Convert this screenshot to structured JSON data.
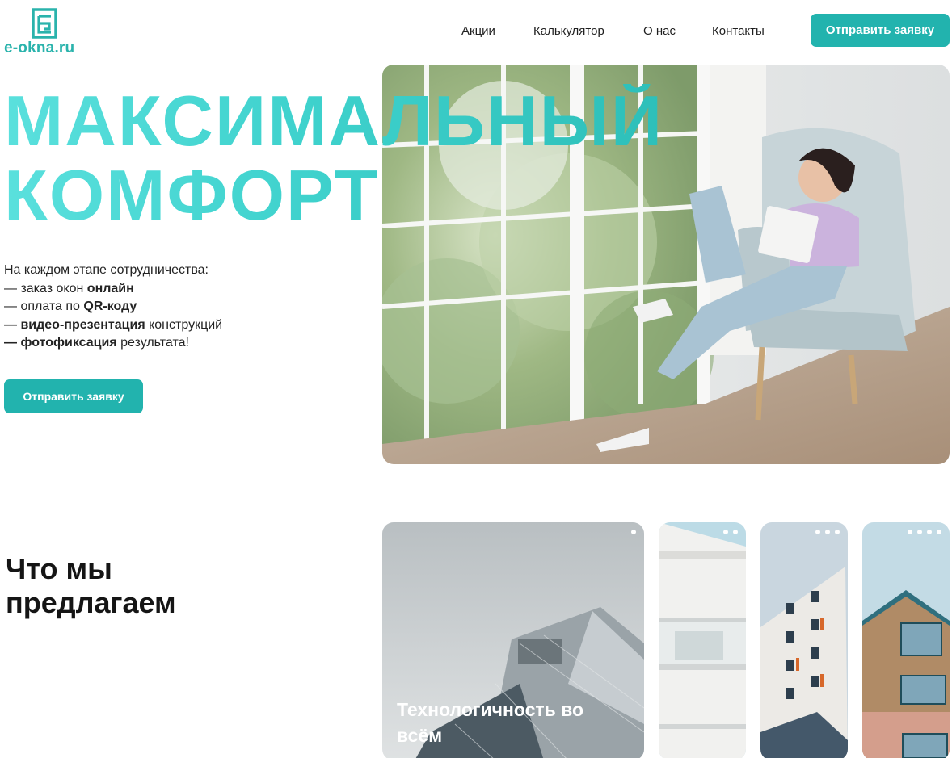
{
  "brand": {
    "name": "e-okna.ru",
    "logo_icon": "window-frame-logo",
    "accent": "#22b3ae"
  },
  "nav": {
    "items": [
      {
        "label": "Акции"
      },
      {
        "label": "Калькулятор"
      },
      {
        "label": "О нас"
      },
      {
        "label": "Контакты"
      }
    ],
    "cta_label": "Отправить заявку"
  },
  "hero": {
    "title_line1": "МАКСИМАЛЬНЫЙ",
    "title_line2": "КОМФОРТ",
    "intro": "На каждом этапе сотрудничества:",
    "items": [
      {
        "prefix": "— заказ окон ",
        "bold": "онлайн",
        "suffix": ""
      },
      {
        "prefix": "— оплата по ",
        "bold": "QR-коду",
        "suffix": ""
      },
      {
        "prefix": "",
        "bold": "— видео-презентация",
        "suffix": " конструкций"
      },
      {
        "prefix": "",
        "bold": "— фотофиксация",
        "suffix": " результата!"
      }
    ],
    "cta_label": "Отправить заявку",
    "photo": "woman-reading-in-armchair-by-window"
  },
  "offers": {
    "title_line1": "Что мы",
    "title_line2": "предлагаем",
    "cards": [
      {
        "label": "Технологичность во всём",
        "dots": 1,
        "photo": "glass-facade-building"
      },
      {
        "label": "",
        "dots": 2,
        "photo": "white-balconies-building"
      },
      {
        "label": "",
        "dots": 3,
        "photo": "highrise-orange-windows"
      },
      {
        "label": "",
        "dots": 4,
        "photo": "wood-brick-house"
      }
    ]
  }
}
